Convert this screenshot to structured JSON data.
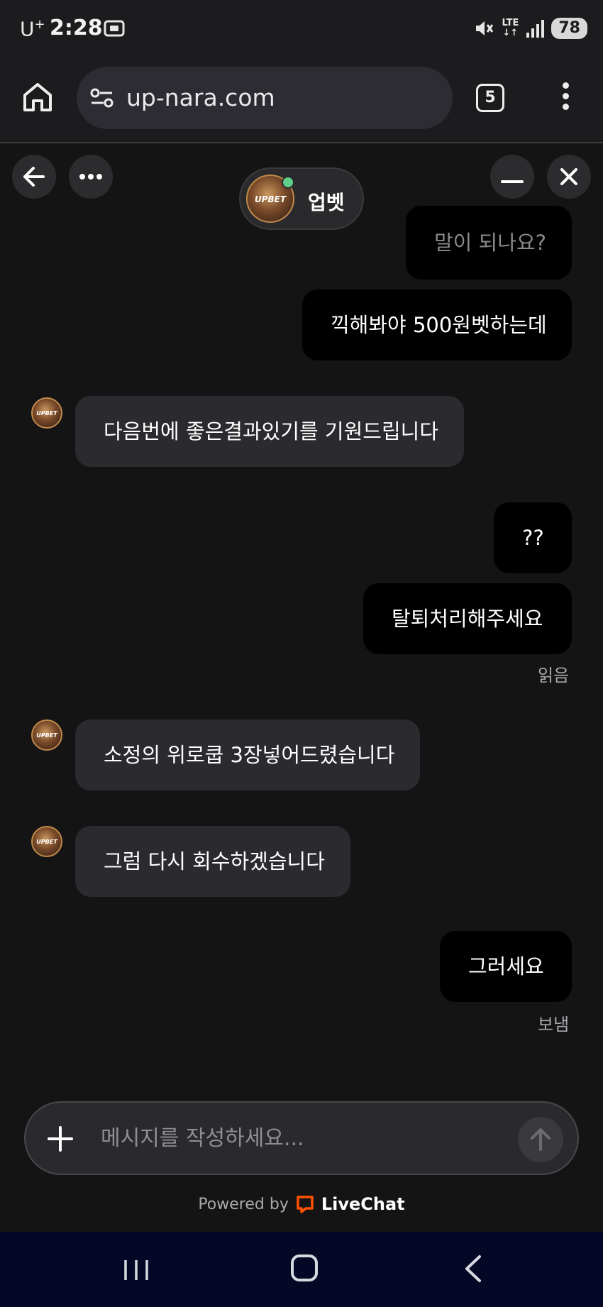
{
  "status_bar": {
    "carrier": "U",
    "carrier_sup": "+",
    "time": "2:28",
    "network": "LTE",
    "battery": "78",
    "icons": [
      "screenshot-icon",
      "mute-icon",
      "lte-icon",
      "signal-icon",
      "battery-icon"
    ]
  },
  "browser": {
    "url": "up-nara.com",
    "tab_count": "5",
    "icons": [
      "home-icon",
      "site-settings-icon",
      "tabs-icon",
      "more-vert-icon"
    ]
  },
  "chat_header": {
    "agent_name": "업벳",
    "avatar_label": "UPBET",
    "online": true,
    "icons": [
      "back-arrow-icon",
      "more-horiz-icon",
      "minimize-icon",
      "close-icon"
    ]
  },
  "messages": [
    {
      "from": "user",
      "text": "말이 되나요?",
      "faded": true
    },
    {
      "from": "user",
      "text": "끽해봐야 500원벳하는데"
    },
    {
      "from": "agent",
      "text": "다음번에 좋은결과있기를 기원드립니다"
    },
    {
      "from": "user",
      "text": "??"
    },
    {
      "from": "user",
      "text": "탈퇴처리해주세요",
      "status": "읽음"
    },
    {
      "from": "agent",
      "text": "소정의 위로쿱 3장넣어드렸습니다"
    },
    {
      "from": "agent",
      "text": "그럼 다시 회수하겠습니다"
    },
    {
      "from": "user",
      "text": "그러세요",
      "status": "보냄"
    }
  ],
  "composer": {
    "placeholder": "메시지를 작성하세요...",
    "icons": [
      "plus-icon",
      "send-arrow-icon"
    ]
  },
  "footer": {
    "powered_by": "Powered by",
    "brand": "LiveChat",
    "brand_color": "#ff5100"
  },
  "nav_bar": {
    "icons": [
      "recents-icon",
      "home-nav-icon",
      "back-nav-icon"
    ]
  },
  "colors": {
    "background": "#151415",
    "user_bubble": "#000000",
    "agent_bubble": "#2b2a2e",
    "online": "#5fcf8a"
  }
}
